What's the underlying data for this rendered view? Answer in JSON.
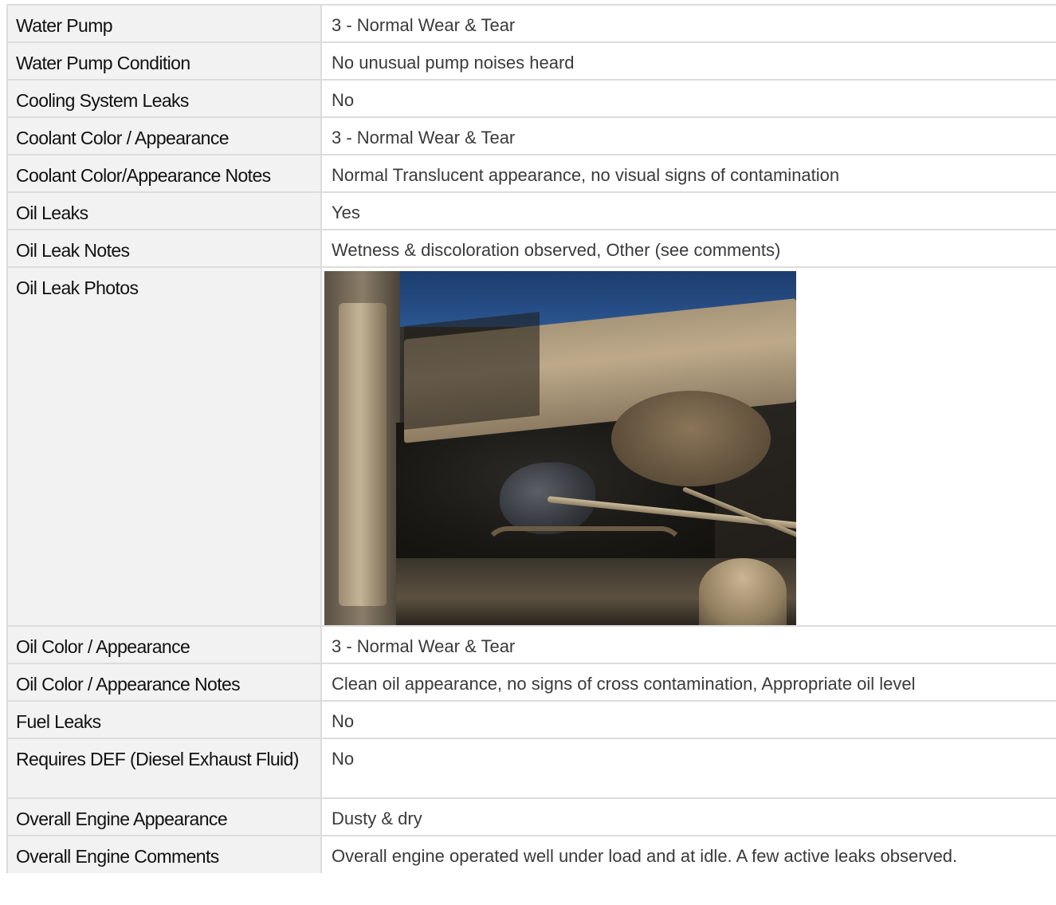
{
  "rows": [
    {
      "label": "Water Pump",
      "value": "3 - Normal Wear & Tear"
    },
    {
      "label": "Water Pump Condition",
      "value": "No unusual pump noises heard"
    },
    {
      "label": "Cooling System Leaks",
      "value": "No"
    },
    {
      "label": "Coolant Color / Appearance",
      "value": "3 - Normal Wear & Tear"
    },
    {
      "label": "Coolant Color/Appearance Notes",
      "value": "Normal Translucent appearance, no visual signs of contamination"
    },
    {
      "label": "Oil Leaks",
      "value": "Yes"
    },
    {
      "label": "Oil Leak Notes",
      "value": "Wetness & discoloration observed, Other (see comments)"
    },
    {
      "label": "Oil Leak Photos",
      "photo": "engine-oil-leak-photo"
    },
    {
      "label": "Oil Color / Appearance",
      "value": "3 - Normal Wear & Tear"
    },
    {
      "label": "Oil Color / Appearance Notes",
      "value": "Clean oil appearance, no signs of cross contamination, Appropriate oil level"
    },
    {
      "label": "Fuel Leaks",
      "value": "No"
    },
    {
      "label": "Requires DEF (Diesel Exhaust Fluid)",
      "value": "No"
    },
    {
      "label": "Overall Engine Appearance",
      "value": "Dusty & dry"
    },
    {
      "label": "Overall Engine Comments",
      "value": "Overall engine operated well under load and at idle. A few active leaks observed."
    }
  ],
  "colors": {
    "label_bg": "#f2f2f2",
    "border": "#dcdcdc",
    "label_text": "#111111",
    "value_text": "#3a3a3a"
  }
}
